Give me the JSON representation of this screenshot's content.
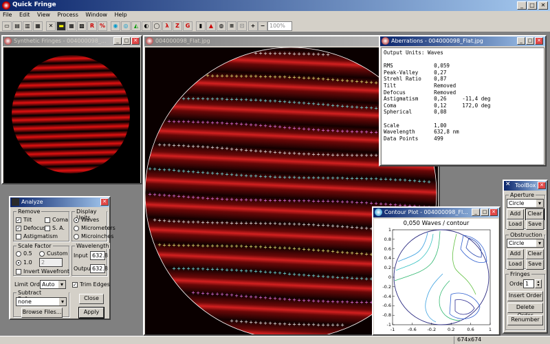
{
  "app": {
    "title": "Quick Fringe",
    "min": "_",
    "max": "□",
    "close": "✕"
  },
  "menu": [
    "File",
    "Edit",
    "View",
    "Process",
    "Window",
    "Help"
  ],
  "toolbar": {
    "zoom": "100%",
    "R_label": "R",
    "Z_label": "Z",
    "G_label": "G"
  },
  "synthetic": {
    "title": "Synthetic Fringes - 004000098_..."
  },
  "flat": {
    "title": "004000098_Flat.jpg"
  },
  "aberrations": {
    "title": "Aberrations - 004000098_Flat.jpg",
    "text": "Output Units: Waves\n\nRMS             0,059\nPeak-Valley     0,27\nStrehl Ratio    0,87\nTilt            Removed\nDefocus         Removed\nAstigmatism     0,26     -11,4 deg\nComa            0,12     172,0 deg\nSpherical       0,08\n\nScale           1,00\nWavelength      632,8 nm\nData Points     499"
  },
  "analyze": {
    "title": "Analyze",
    "remove_legend": "Remove",
    "tilt": "Tilt",
    "coma": "Coma",
    "defocus": "Defocus",
    "sa": "S. A.",
    "astig": "Astigmatism",
    "units_legend": "Display Units",
    "waves": "Waves",
    "micrometers": "Micrometers",
    "microinches": "Microinches",
    "scale_legend": "Scale Factor",
    "s05": "0.5",
    "custom": "Custom",
    "s10": "1.0",
    "custom_val": "2",
    "invert": "Invert Wavefront",
    "wave_legend": "Wavelength",
    "input": "Input",
    "input_val": "632.8",
    "output": "Output",
    "output_val": "632.8",
    "limit_order": "Limit Order",
    "limit_val": "Auto",
    "trim": "Trim Edges",
    "subref_legend": "Subtract Reference",
    "subref_val": "none",
    "browse": "Browse Files...",
    "close": "Close",
    "apply": "Apply"
  },
  "contour": {
    "title": "Contour Plot - 004000098_Fl...",
    "caption": "0,050 Waves / contour",
    "yticks": [
      "1",
      "0.8",
      "0.6",
      "0.4",
      "0.2",
      "0",
      "-0.2",
      "-0.4",
      "-0.6",
      "-0.8",
      "-1"
    ],
    "xticks": [
      "-1",
      "-0.6",
      "-0.2",
      "0.2",
      "0.6",
      "1"
    ]
  },
  "toolbox": {
    "title": "ToolBox",
    "aperture": "Aperture",
    "ap_val": "Circle",
    "add": "Add",
    "clear": "Clear",
    "load": "Load",
    "save": "Save",
    "obstruction": "Obstruction",
    "ob_val": "Circle",
    "fringes": "Fringes",
    "order": "Order",
    "order_val": "1",
    "insert_order": "Insert Order",
    "delete_order": "Delete Order",
    "renumber": "Renumber"
  },
  "status": {
    "size": "674x674"
  }
}
